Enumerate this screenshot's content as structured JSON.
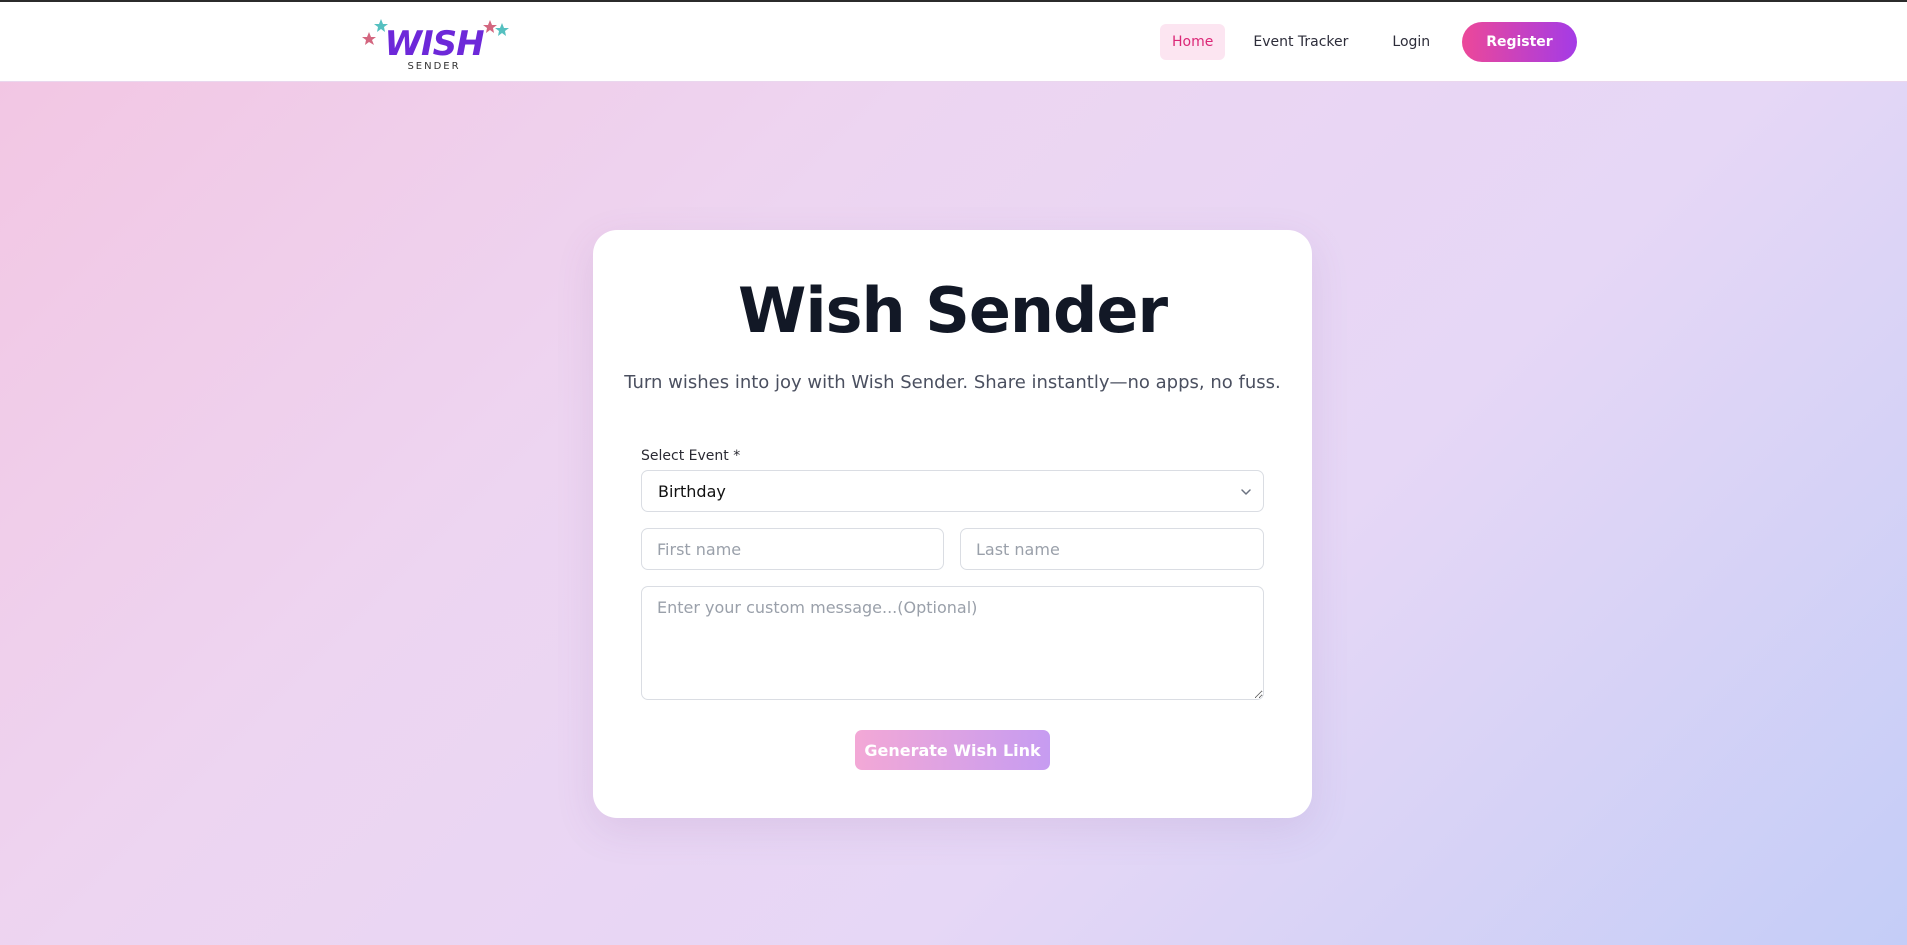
{
  "header": {
    "logo": {
      "title": "WISH",
      "subtitle": "SENDER"
    },
    "nav": {
      "home": "Home",
      "event_tracker": "Event Tracker",
      "login": "Login",
      "register": "Register"
    }
  },
  "main": {
    "title": "Wish Sender",
    "tagline": "Turn wishes into joy with Wish Sender. Share instantly—no apps, no fuss.",
    "form": {
      "event_label": "Select Event *",
      "event_selected": "Birthday",
      "first_name_placeholder": "First name",
      "last_name_placeholder": "Last name",
      "message_placeholder": "Enter your custom message...(Optional)",
      "submit_label": "Generate Wish Link"
    }
  },
  "colors": {
    "brand_purple": "#6d28d9",
    "accent_pink": "#ec4899",
    "nav_active_bg": "#fce5f1",
    "nav_active_text": "#db2777",
    "title_text": "#121826"
  },
  "icons": {
    "logo_stars": "star-icon",
    "select_chevron": "chevron-down-icon"
  }
}
